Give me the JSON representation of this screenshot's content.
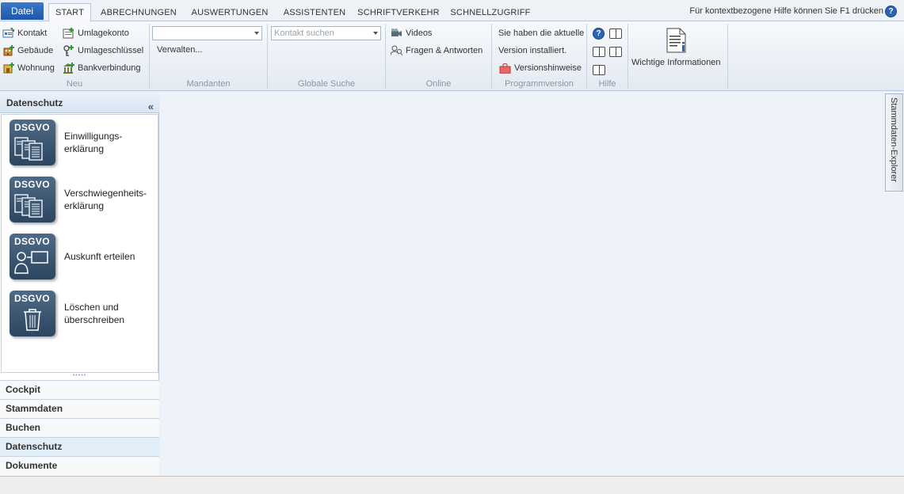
{
  "tabs": {
    "file": "Datei",
    "items": [
      "START",
      "ABRECHNUNGEN",
      "AUSWERTUNGEN",
      "ASSISTENTEN",
      "SCHRIFTVERKEHR",
      "SCHNELLZUGRIFF"
    ],
    "active": "START"
  },
  "help_hint": "Für kontextbezogene Hilfe können Sie F1 drücken",
  "ribbon": {
    "neu": {
      "label": "Neu",
      "kontakt": "Kontakt",
      "gebaeude": "Gebäude",
      "wohnung": "Wohnung",
      "umlagekonto": "Umlagekonto",
      "umlageschluessel": "Umlageschlüssel",
      "bankverbindung": "Bankverbindung"
    },
    "mandanten": {
      "label": "Mandanten",
      "combo_value": "",
      "verwalten": "Verwalten..."
    },
    "globale_suche": {
      "label": "Globale Suche",
      "placeholder": "Kontakt suchen"
    },
    "online": {
      "label": "Online",
      "videos": "Videos",
      "faq": "Fragen & Antworten"
    },
    "programmversion": {
      "label": "Programmversion",
      "line1": "Sie haben die aktuelle",
      "line2": "Version installiert.",
      "hinweise": "Versionshinweise"
    },
    "hilfe": {
      "label": "Hilfe"
    },
    "info": {
      "wichtige": "Wichtige Informationen"
    }
  },
  "left_panel": {
    "title": "Datenschutz",
    "items": [
      {
        "badge": "DSGVO",
        "label_line1": "Einwilligungs-",
        "label_line2": "erklärung"
      },
      {
        "badge": "DSGVO",
        "label_line1": "Verschwiegenheits-",
        "label_line2": "erklärung"
      },
      {
        "badge": "DSGVO",
        "label_line1": "Auskunft erteilen",
        "label_line2": ""
      },
      {
        "badge": "DSGVO",
        "label_line1": "Löschen und",
        "label_line2": "überschreiben"
      }
    ],
    "nav": [
      "Cockpit",
      "Stammdaten",
      "Buchen",
      "Datenschutz",
      "Dokumente"
    ],
    "nav_active": "Datenschutz"
  },
  "side_tab": "Stammdaten-Explorer",
  "colors": {
    "file_tab": "#2a64b5",
    "dsgvo_icon": "#3b5773",
    "main_bg": "#eef2f9"
  }
}
